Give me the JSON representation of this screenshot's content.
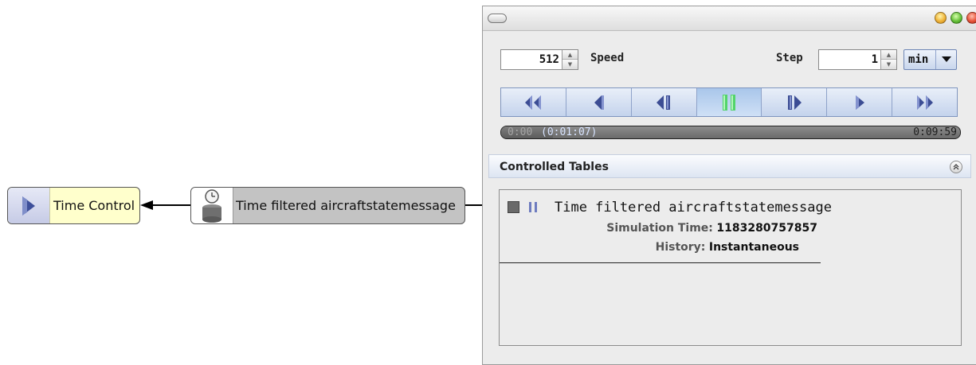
{
  "diagram": {
    "time_control_label": "Time Control",
    "filter_label": "Time filtered aircraftstatemessage"
  },
  "controls": {
    "speed_value": "512",
    "speed_label": "Speed",
    "step_label": "Step",
    "step_value": "1",
    "step_unit": "min",
    "transport_buttons": [
      "rewind-fast",
      "step-back",
      "step-back-frame",
      "pause",
      "step-forward-frame",
      "play",
      "fast-forward"
    ],
    "active_button": "pause",
    "accent_color": "#52d46a"
  },
  "timeline": {
    "start": "0:00",
    "current": "(0:01:07)",
    "end": "0:09:59",
    "progress_fraction": 0.112
  },
  "panel": {
    "title": "Controlled Tables",
    "entry": {
      "name": "Time filtered aircraftstatemessage",
      "sim_time_label": "Simulation Time:",
      "sim_time_value": "1183280757857",
      "history_label": "History:",
      "history_value": "Instantaneous"
    }
  }
}
